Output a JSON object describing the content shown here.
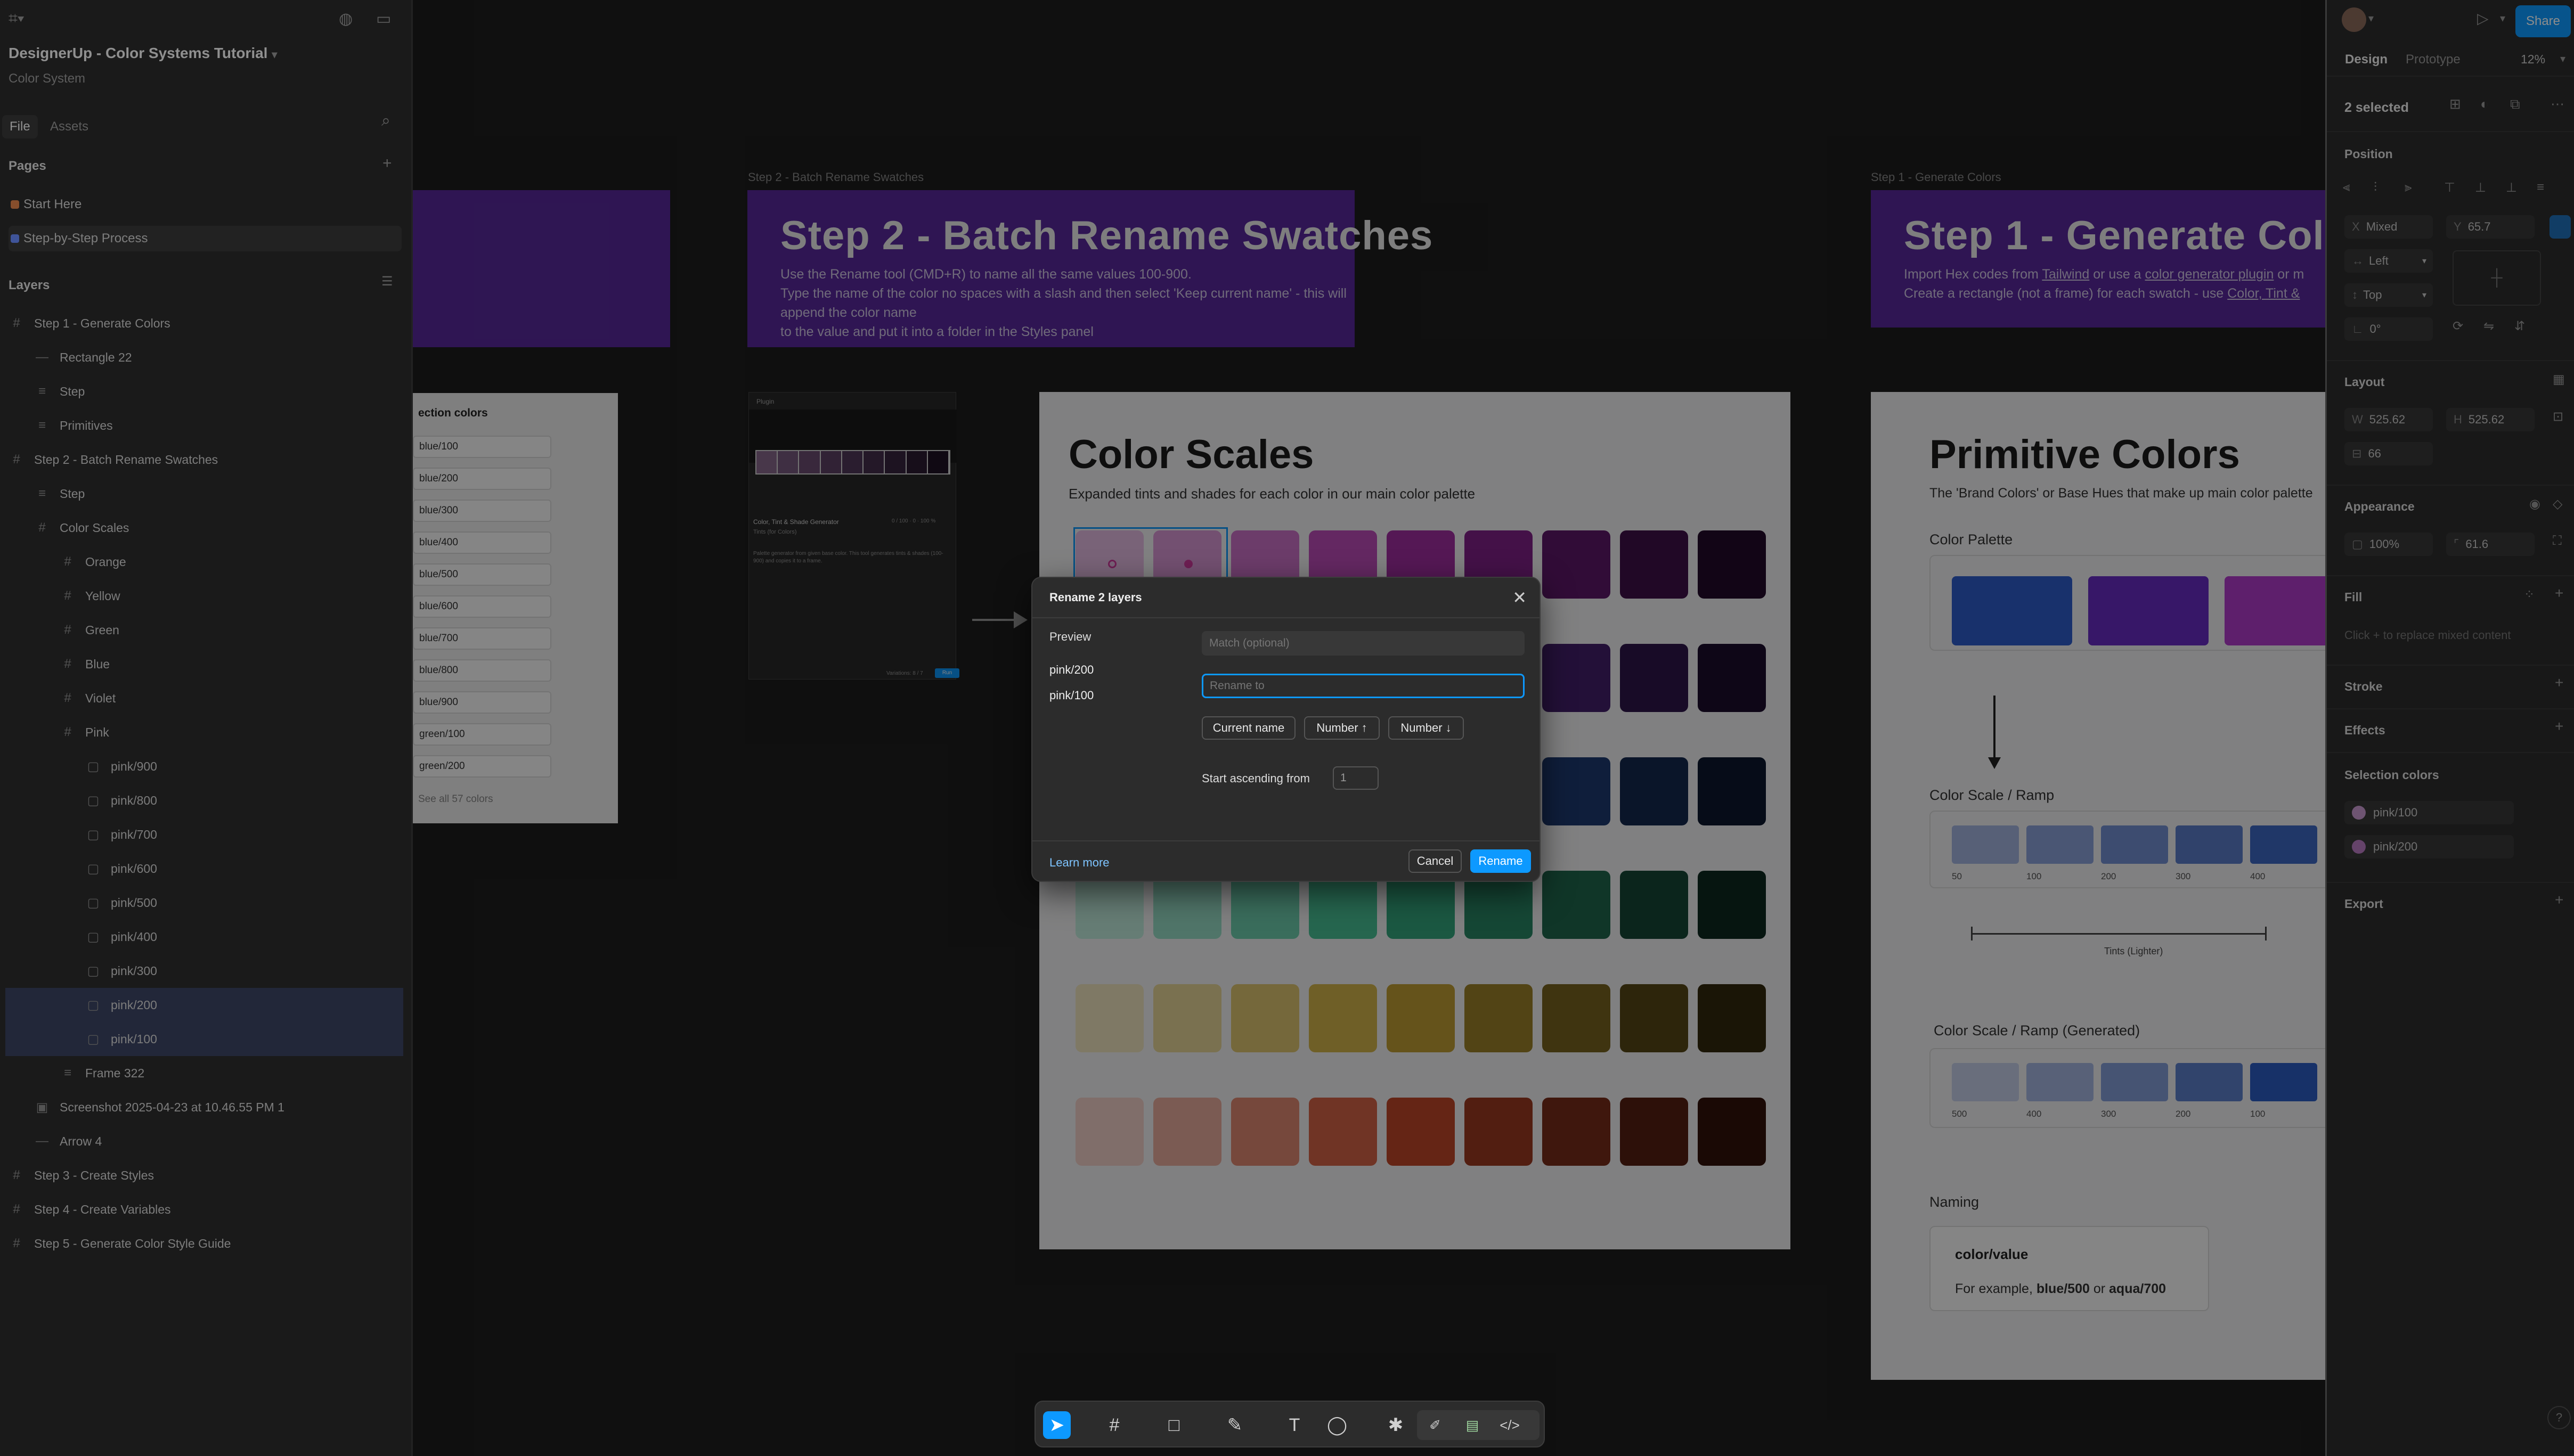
{
  "project": {
    "title": "DesignerUp - Color Systems Tutorial",
    "subtitle": "Color System"
  },
  "left_tabs": {
    "file": "File",
    "assets": "Assets"
  },
  "pages": {
    "heading": "Pages",
    "items": [
      {
        "label": "Start Here",
        "color": "#e0824a"
      },
      {
        "label": "Step-by-Step Process",
        "color": "#6a8cff"
      }
    ]
  },
  "layers": {
    "heading": "Layers",
    "items": [
      {
        "label": "Step 1 - Generate Colors",
        "icon": "frame-icon",
        "indent": 0
      },
      {
        "label": "Rectangle 22",
        "icon": "line-icon",
        "indent": 1
      },
      {
        "label": "Step",
        "icon": "text-icon",
        "indent": 1
      },
      {
        "label": "Primitives",
        "icon": "text-icon",
        "indent": 1
      },
      {
        "label": "Step 2 - Batch Rename Swatches",
        "icon": "frame-icon",
        "indent": 0
      },
      {
        "label": "Step",
        "icon": "text-icon",
        "indent": 1
      },
      {
        "label": "Color Scales",
        "icon": "frame-icon",
        "indent": 1
      },
      {
        "label": "Orange",
        "icon": "frame-icon",
        "indent": 2
      },
      {
        "label": "Yellow",
        "icon": "frame-icon",
        "indent": 2
      },
      {
        "label": "Green",
        "icon": "frame-icon",
        "indent": 2
      },
      {
        "label": "Blue",
        "icon": "frame-icon",
        "indent": 2
      },
      {
        "label": "Violet",
        "icon": "frame-icon",
        "indent": 2
      },
      {
        "label": "Pink",
        "icon": "frame-icon",
        "indent": 2
      },
      {
        "label": "pink/900",
        "icon": "rect-icon",
        "indent": 3
      },
      {
        "label": "pink/800",
        "icon": "rect-icon",
        "indent": 3
      },
      {
        "label": "pink/700",
        "icon": "rect-icon",
        "indent": 3
      },
      {
        "label": "pink/600",
        "icon": "rect-icon",
        "indent": 3
      },
      {
        "label": "pink/500",
        "icon": "rect-icon",
        "indent": 3
      },
      {
        "label": "pink/400",
        "icon": "rect-icon",
        "indent": 3
      },
      {
        "label": "pink/300",
        "icon": "rect-icon",
        "indent": 3
      },
      {
        "label": "pink/200",
        "icon": "rect-icon",
        "indent": 3,
        "selected": true
      },
      {
        "label": "pink/100",
        "icon": "rect-icon",
        "indent": 3,
        "selected": true
      },
      {
        "label": "Frame 322",
        "icon": "text-icon",
        "indent": 2
      },
      {
        "label": "Screenshot 2025-04-23 at 10.46.55 PM 1",
        "icon": "image-icon",
        "indent": 1
      },
      {
        "label": "Arrow 4",
        "icon": "line-icon",
        "indent": 1
      },
      {
        "label": "Step 3 - Create Styles",
        "icon": "frame-icon",
        "indent": 0
      },
      {
        "label": "Step 4 - Create Variables",
        "icon": "frame-icon",
        "indent": 0
      },
      {
        "label": "Step 5 - Generate Color Style Guide",
        "icon": "frame-icon",
        "indent": 0
      }
    ]
  },
  "canvas": {
    "step2": {
      "label": "Step 2 - Batch Rename Swatches",
      "title": "Step 2 - Batch Rename Swatches",
      "lines": [
        "Use the Rename tool (CMD+R) to name all the same values 100-900.",
        "Type the name of the color no spaces with a slash and then select 'Keep current name' - this will append the color name",
        "to the value and put it into a folder in the Styles panel"
      ]
    },
    "step1": {
      "label": "Step 1 - Generate Colors",
      "title": "Step 1 - Generate Colo",
      "line1_a": "Import Hex codes from ",
      "line1_link1": "Tailwind",
      "line1_b": " or use a ",
      "line1_link2": "color generator plugin",
      "line1_c": " or m",
      "line2_a": "Create a rectangle (not a frame) for each swatch - use ",
      "line2_link": "Color, Tint &"
    },
    "selection_colors_card": {
      "title": "ection colors",
      "items": [
        "blue/100",
        "blue/200",
        "blue/300",
        "blue/400",
        "blue/500",
        "blue/600",
        "blue/700",
        "blue/800",
        "blue/900",
        "green/100",
        "green/200"
      ],
      "more": "See all 57 colors"
    },
    "plugin_card": {
      "header": "Plugin",
      "name": "Color, Tint & Shade Generator",
      "sub": "Tints (for Colors)",
      "desc": "Palette generator from given base color. This tool generates tints & shades (100-900) and copies it to a frame.",
      "footer_left": "Variations: 8 / 7",
      "footer_btn": "Run",
      "meta": "0 / 100 · 0 · 100 %"
    },
    "color_scales": {
      "title": "Color Scales",
      "subtitle": "Expanded tints and shades for each color in our main color palette",
      "rows": [
        [
          "#e8bfe6",
          "#dc9ad9",
          "#cf73cb",
          "#c04ebd",
          "#a42ea4",
          "#82218a",
          "#5f186a",
          "#40114a",
          "#240a2b"
        ],
        [
          "#d7c0ee",
          "#c19ae3",
          "#a874d6",
          "#8d50c7",
          "#7236ae",
          "#5a2a8c",
          "#44206b",
          "#2f164b",
          "#1b0d2c"
        ],
        [
          "#c0cff0",
          "#97b1e6",
          "#6f92da",
          "#4b75cd",
          "#3360b5",
          "#284d93",
          "#1e3b71",
          "#152a50",
          "#0c182e"
        ],
        [
          "#c3efe1",
          "#99e1c9",
          "#6fd2b0",
          "#49c397",
          "#34a97f",
          "#298966",
          "#1f684e",
          "#164837",
          "#0c291f"
        ],
        [
          "#f3e8c2",
          "#ead89a",
          "#e0c772",
          "#d5b64c",
          "#c19f34",
          "#9e8229",
          "#7a641f",
          "#574716",
          "#33290c"
        ],
        [
          "#f5d3cc",
          "#ecaf9f",
          "#e28a73",
          "#d76547",
          "#c2482a",
          "#9e3a22",
          "#7a2c1a",
          "#571f12",
          "#33120a"
        ]
      ]
    },
    "primitive_colors": {
      "title": "Primitive Colors",
      "subtitle": "The 'Brand Colors' or Base Hues that make up main color palette",
      "palette_label": "Color Palette",
      "palette": [
        "#2f5fd0",
        "#6a2cc8",
        "#b53cd0"
      ],
      "ramp_label": "Color Scale / Ramp",
      "ramp": [
        {
          "c": "#a7b9e5",
          "l": "50"
        },
        {
          "c": "#8ea5de",
          "l": "100"
        },
        {
          "c": "#7692d6",
          "l": "200"
        },
        {
          "c": "#5c7fce",
          "l": "300"
        },
        {
          "c": "#3f6ac8",
          "l": "400"
        }
      ],
      "tints_label": "Tints (Lighter)",
      "ramp2_label": "Color Scale / Ramp (Generated)",
      "ramp2": [
        {
          "c": "#c9d3ee",
          "l": "500"
        },
        {
          "c": "#a9bbe6",
          "l": "400"
        },
        {
          "c": "#86a1dc",
          "l": "300"
        },
        {
          "c": "#5f83d0",
          "l": "200"
        },
        {
          "c": "#2c5ec8",
          "l": "100"
        }
      ],
      "naming_label": "Naming",
      "naming_value": "color/value",
      "naming_example_a": "For example, ",
      "naming_example_b": "blue/500",
      "naming_example_c": " or ",
      "naming_example_d": "aqua/700"
    }
  },
  "dialog": {
    "title": "Rename 2 layers",
    "preview_label": "Preview",
    "preview_items": [
      "pink/200",
      "pink/100"
    ],
    "match_placeholder": "Match (optional)",
    "rename_placeholder": "Rename to",
    "chips": [
      "Current name",
      "Number ↑",
      "Number ↓"
    ],
    "start_label": "Start ascending from",
    "start_value": "1",
    "learn_more": "Learn more",
    "cancel": "Cancel",
    "rename": "Rename",
    "accent": "#0d99ff"
  },
  "right_panel": {
    "share": "Share",
    "tabs": {
      "design": "Design",
      "prototype": "Prototype"
    },
    "zoom": "12%",
    "selected": "2 selected",
    "position": {
      "heading": "Position",
      "x_label": "X",
      "x": "Mixed",
      "y_label": "Y",
      "y": "65.7",
      "h_constraint": "Left",
      "v_constraint": "Top",
      "rotation": "0°"
    },
    "layout": {
      "heading": "Layout",
      "w_label": "W",
      "w": "525.62",
      "h_label": "H",
      "h": "525.62",
      "gap": "66"
    },
    "appearance": {
      "heading": "Appearance",
      "opacity": "100%",
      "radius": "61.6"
    },
    "fill": {
      "heading": "Fill",
      "hint": "Click + to replace mixed content"
    },
    "stroke": "Stroke",
    "effects": "Effects",
    "selection_colors": {
      "heading": "Selection colors",
      "items": [
        {
          "label": "pink/100",
          "color": "#c99ad0"
        },
        {
          "label": "pink/200",
          "color": "#b87ac2"
        }
      ]
    },
    "export": "Export"
  }
}
